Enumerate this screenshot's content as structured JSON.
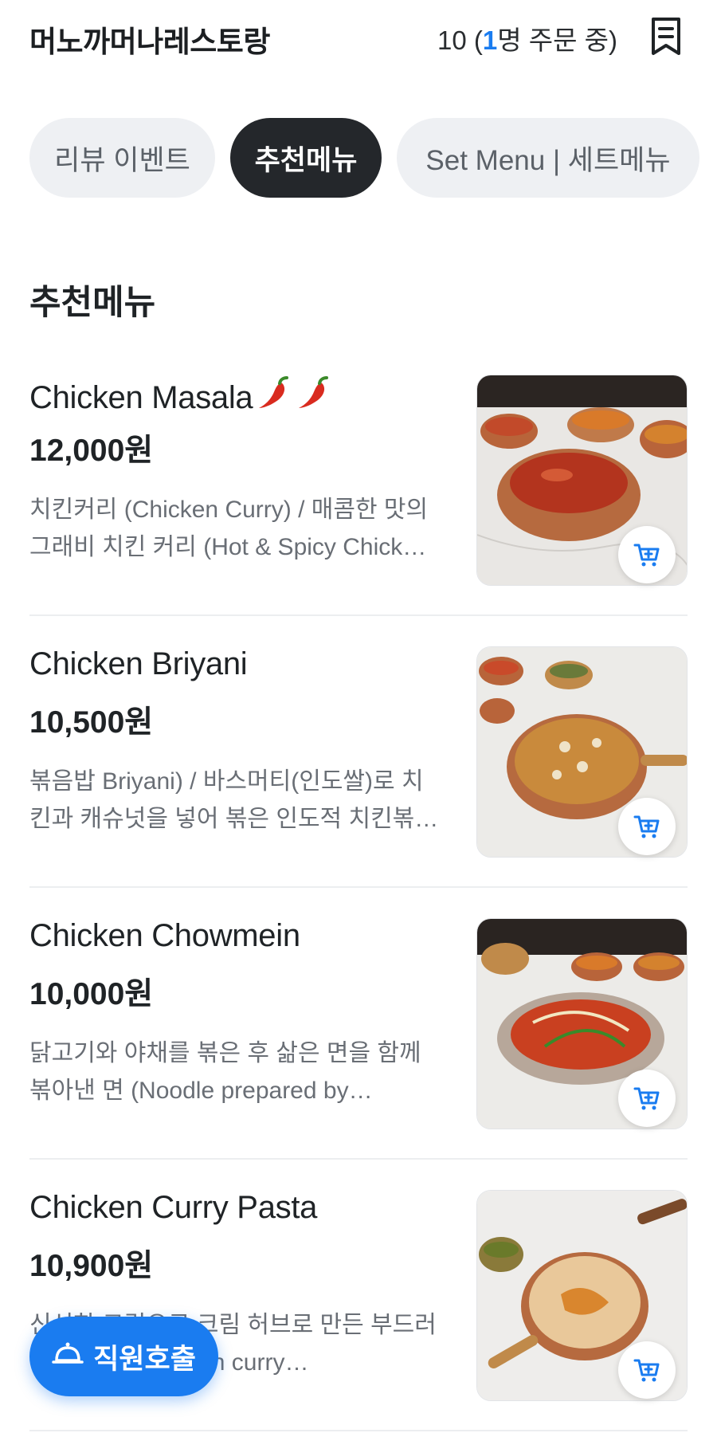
{
  "header": {
    "store_name": "머노까머나레스토랑",
    "table_number": "10",
    "order_open": " (",
    "order_count": "1",
    "order_suffix": "명 주문 중)",
    "receipt_icon": "receipt-icon"
  },
  "tabs": [
    {
      "label": "리뷰 이벤트",
      "active": false
    },
    {
      "label": "추천메뉴",
      "active": true
    },
    {
      "label": "Set Menu | 세트메뉴",
      "active": false
    }
  ],
  "section": {
    "title": "추천메뉴"
  },
  "items": [
    {
      "name": "Chicken Masala",
      "spicy_icons": [
        "chili-pepper-icon",
        "chili-pepper-icon"
      ],
      "price": "12,000원",
      "description": "치킨커리 (Chicken Curry) / 매콤한 맛의 그래비 치킨 커리 (Hot & Spicy Chick…",
      "image_icon": "food-photo",
      "cart_icon": "add-to-cart-icon"
    },
    {
      "name": "Chicken Briyani",
      "price": "10,500원",
      "description": "볶음밥 Briyani) / 바스머티(인도쌀)로 치킨과 캐슈넛을 넣어 볶은 인도적 치킨볶…",
      "image_icon": "food-photo",
      "cart_icon": "add-to-cart-icon"
    },
    {
      "name": "Chicken Chowmein",
      "price": "10,000원",
      "description": "닭고기와 야채를 볶은 후 삶은 면을 함께 볶아낸 면 (Noodle prepared by…",
      "image_icon": "food-photo",
      "cart_icon": "add-to-cart-icon"
    },
    {
      "name": "Chicken Curry Pasta",
      "price": "10,900원",
      "description": "신선한 크림으로 크림 허브로 만든 부드러운 파스타 (Chicken curry…",
      "image_icon": "food-photo",
      "cart_icon": "add-to-cart-icon"
    }
  ],
  "call_staff": {
    "label": "직원호출",
    "icon": "bell-icon"
  },
  "colors": {
    "accent": "#1a7cf0",
    "active_tab": "#24272b",
    "tab_bg": "#eef0f3"
  }
}
